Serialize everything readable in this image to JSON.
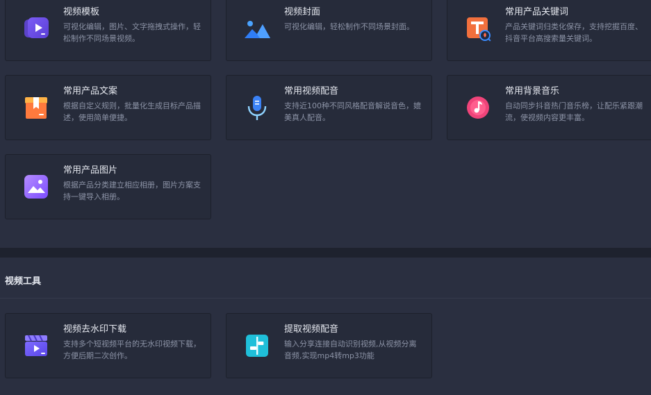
{
  "top_cards": [
    {
      "title": "视频模板",
      "desc": "可视化编辑，图片、文字拖拽式操作，轻松制作不同场景视频。",
      "icon": "video-template-icon"
    },
    {
      "title": "视频封面",
      "desc": "可视化编辑，轻松制作不同场景封面。",
      "icon": "mountain-icon"
    },
    {
      "title": "常用产品关键词",
      "desc": "产品关键词归类化保存，支持挖掘百度、抖音平台高搜索量关键词。",
      "icon": "keyword-icon"
    },
    {
      "title": "常用产品文案",
      "desc": "根据自定义规则，批量化生成目标产品描述，使用简单便捷。",
      "icon": "box-icon"
    },
    {
      "title": "常用视频配音",
      "desc": "支持近100种不同风格配音解说音色，媲美真人配音。",
      "icon": "microphone-icon"
    },
    {
      "title": "常用背景音乐",
      "desc": "自动同步抖音热门音乐榜，让配乐紧跟潮流，使视频内容更丰富。",
      "icon": "music-note-icon"
    },
    {
      "title": "常用产品图片",
      "desc": "根据产品分类建立相应相册，图片方案支持一键导入相册。",
      "icon": "image-icon"
    }
  ],
  "video_tools": {
    "section_title": "视频工具",
    "cards": [
      {
        "title": "视频去水印下载",
        "desc": "支持多个短视频平台的无水印视频下载，方便后期二次创作。",
        "icon": "clapper-icon"
      },
      {
        "title": "提取视频配音",
        "desc": "输入分享连接自动识别视频,从视频分离音频,实现mp4转mp3功能",
        "icon": "split-icon"
      }
    ]
  },
  "colors": {
    "background": "#2a2f40",
    "card_background": "#262b3a",
    "title_text": "#e6e9f0",
    "desc_text": "#8c93a6"
  }
}
